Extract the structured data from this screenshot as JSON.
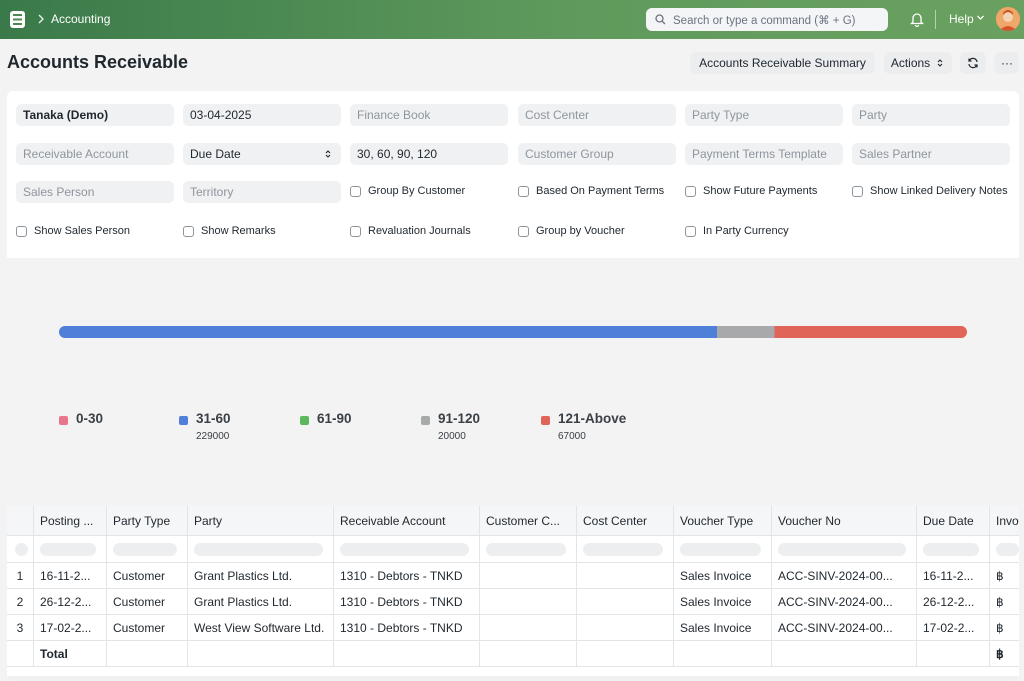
{
  "navbar": {
    "breadcrumb": "Accounting",
    "search_placeholder": "Search or type a command (⌘ + G)",
    "help_label": "Help",
    "icons": [
      "app-logo-icon",
      "chevron-right-icon",
      "search-icon",
      "bell-icon",
      "chevron-down-icon",
      "avatar"
    ]
  },
  "page": {
    "title": "Accounts Receivable",
    "summary_button": "Accounts Receivable Summary",
    "actions_button": "Actions",
    "more_button": "···"
  },
  "filters": {
    "company": "Tanaka (Demo)",
    "report_date": "03-04-2025",
    "finance_book": "Finance Book",
    "cost_center": "Cost Center",
    "party_type": "Party Type",
    "party": "Party",
    "receivable_account": "Receivable Account",
    "ageing_based_on": "Due Date",
    "ageing_ranges": "30, 60, 90, 120",
    "customer_group": "Customer Group",
    "payment_terms_template": "Payment Terms Template",
    "sales_partner": "Sales Partner",
    "sales_person": "Sales Person",
    "territory": "Territory",
    "checks": {
      "group_by_customer": "Group By Customer",
      "based_on_payment_terms": "Based On Payment Terms",
      "show_future_payments": "Show Future Payments",
      "show_linked_delivery_notes": "Show Linked Delivery Notes",
      "show_sales_person": "Show Sales Person",
      "show_remarks": "Show Remarks",
      "revaluation_journals": "Revaluation Journals",
      "group_by_voucher": "Group by Voucher",
      "in_party_currency": "In Party Currency"
    }
  },
  "chart_data": {
    "type": "bar",
    "stacked": true,
    "orientation": "horizontal",
    "categories": [
      "0-30",
      "31-60",
      "61-90",
      "91-120",
      "121-Above"
    ],
    "values": [
      0,
      229000,
      0,
      20000,
      67000
    ],
    "value_labels": [
      "",
      "229000",
      "",
      "20000",
      "67000"
    ],
    "colors": [
      "#e8768a",
      "#4f7fd8",
      "#5cb85c",
      "#a7a9ab",
      "#e06458"
    ],
    "legend_position": "bottom"
  },
  "table": {
    "columns": [
      "Posting ...",
      "Party Type",
      "Party",
      "Receivable Account",
      "Customer C...",
      "Cost Center",
      "Voucher Type",
      "Voucher No",
      "Due Date",
      "Invo"
    ],
    "rows": [
      {
        "num": "1",
        "posting": "16-11-2...",
        "party_type": "Customer",
        "party": "Grant Plastics Ltd.",
        "account": "1310 - Debtors - TNKD",
        "customer_c": "",
        "cost_center": "",
        "voucher_type": "Sales Invoice",
        "voucher_no": "ACC-SINV-2024-00...",
        "due_date": "16-11-2...",
        "inv": "฿"
      },
      {
        "num": "2",
        "posting": "26-12-2...",
        "party_type": "Customer",
        "party": "Grant Plastics Ltd.",
        "account": "1310 - Debtors - TNKD",
        "customer_c": "",
        "cost_center": "",
        "voucher_type": "Sales Invoice",
        "voucher_no": "ACC-SINV-2024-00...",
        "due_date": "26-12-2...",
        "inv": "฿"
      },
      {
        "num": "3",
        "posting": "17-02-2...",
        "party_type": "Customer",
        "party": "West View Software Ltd.",
        "account": "1310 - Debtors - TNKD",
        "customer_c": "",
        "cost_center": "",
        "voucher_type": "Sales Invoice",
        "voucher_no": "ACC-SINV-2024-00...",
        "due_date": "17-02-2...",
        "inv": "฿"
      }
    ],
    "total_label": "Total",
    "total_currency": "฿"
  }
}
